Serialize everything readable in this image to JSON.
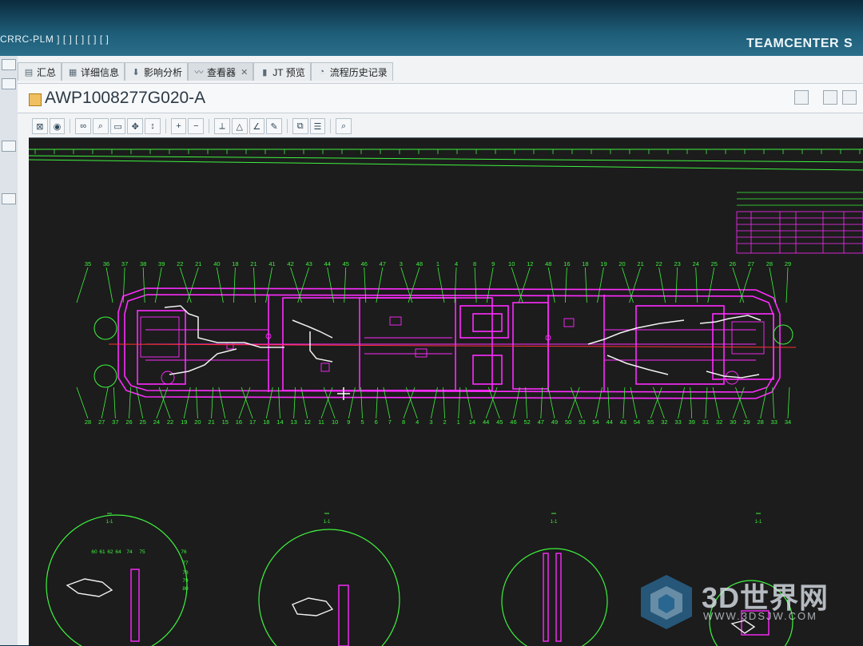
{
  "header": {
    "breadcrumb": "CRRC-PLM ] [ ] [ ] [ ] [ ]",
    "brand": "TEAMCENTER",
    "brand_suffix": "S"
  },
  "tabs": [
    {
      "label": "汇总",
      "icon": "summary-icon"
    },
    {
      "label": "详细信息",
      "icon": "details-icon"
    },
    {
      "label": "影响分析",
      "icon": "impact-analysis-icon"
    },
    {
      "label": "查看器",
      "icon": "viewer-icon",
      "active": true,
      "closable": true
    },
    {
      "label": "JT 预览",
      "icon": "jt-preview-icon"
    },
    {
      "label": "流程历史记录",
      "icon": "process-history-icon"
    }
  ],
  "document": {
    "title": "AWP1008277G020-A"
  },
  "toolbar": {
    "tools": [
      "fit-view-icon",
      "view-options-icon",
      "glasses-icon",
      "zoom-window-icon",
      "zoom-page-icon",
      "pan-icon",
      "vertical-pan-icon",
      "zoom-in-icon",
      "zoom-out-icon",
      "measure-icon",
      "measure-area-icon",
      "measure-angle-icon",
      "markup-icon",
      "compare-icon",
      "layers-icon",
      "search-icon"
    ]
  },
  "drawing": {
    "top_balloons": [
      "35",
      "36",
      "37",
      "38",
      "39",
      "22",
      "21",
      "40",
      "18",
      "21",
      "41",
      "42",
      "43",
      "44",
      "45",
      "46",
      "47",
      "3",
      "48",
      "1",
      "4",
      "8",
      "9",
      "10",
      "12",
      "48",
      "16",
      "18",
      "19",
      "20",
      "21",
      "22",
      "23",
      "24",
      "25",
      "26",
      "27",
      "28",
      "29"
    ],
    "bottom_balloons": [
      "28",
      "27",
      "37",
      "26",
      "25",
      "24",
      "22",
      "19",
      "20",
      "21",
      "15",
      "16",
      "17",
      "18",
      "14",
      "13",
      "12",
      "11",
      "10",
      "9",
      "5",
      "6",
      "7",
      "8",
      "4",
      "3",
      "2",
      "1",
      "14",
      "44",
      "45",
      "46",
      "52",
      "47",
      "49",
      "50",
      "53",
      "54",
      "44",
      "43",
      "54",
      "55",
      "32",
      "33",
      "39",
      "31",
      "32",
      "30",
      "29",
      "28",
      "33",
      "34"
    ],
    "section_labels": [
      "1-1",
      "1-1",
      "1-1",
      "1-1"
    ],
    "detail_balloons": [
      "60",
      "61",
      "62",
      "64",
      "74",
      "75",
      "76",
      "77",
      "78",
      "79",
      "80"
    ]
  },
  "watermark": {
    "text": "3D世界网",
    "url": "WWW.3DSJW.COM"
  },
  "colors": {
    "drawing_magenta": "#ff2cff",
    "drawing_green": "#3ef23e",
    "drawing_red": "#ff3030",
    "canvas_bg": "#1c1c1c"
  }
}
